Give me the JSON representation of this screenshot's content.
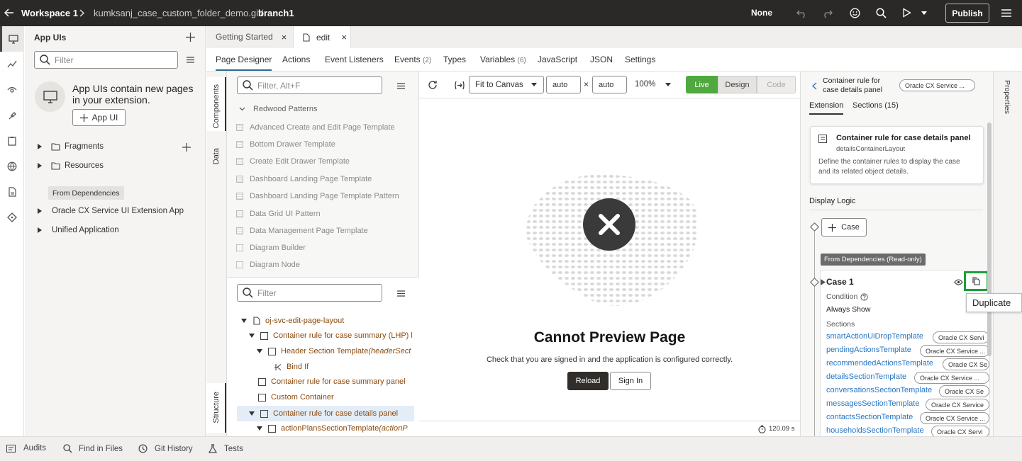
{
  "header": {
    "workspace": "Workspace 1",
    "repo": "kumksanj_case_custom_folder_demo.git/",
    "branch": "branch1",
    "mode": "None",
    "publish_label": "Publish"
  },
  "rail": {
    "icons": [
      "monitor-icon",
      "flow-icon",
      "eye-icon",
      "paint-icon",
      "clipboard-icon",
      "globe-icon",
      "document-icon",
      "git-icon"
    ]
  },
  "navigator": {
    "title": "App UIs",
    "filter_placeholder": "Filter",
    "empty_message_line1": "App UIs contain new pages",
    "empty_message_line2": "in your extension.",
    "app_ui_button": "App UI",
    "fragments": "Fragments",
    "resources": "Resources",
    "from_dependencies": "From Dependencies",
    "dep_items": [
      "Oracle CX Service UI Extension App",
      "Unified Application"
    ]
  },
  "editor_tabs": [
    {
      "label": "Getting Started"
    },
    {
      "label": "edit"
    }
  ],
  "sub_tabs": [
    {
      "label": "Page Designer",
      "count": ""
    },
    {
      "label": "Actions",
      "count": ""
    },
    {
      "label": "Event Listeners",
      "count": ""
    },
    {
      "label": "Events",
      "count": "(2)"
    },
    {
      "label": "Types",
      "count": ""
    },
    {
      "label": "Variables",
      "count": "(6)"
    },
    {
      "label": "JavaScript",
      "count": ""
    },
    {
      "label": "JSON",
      "count": ""
    },
    {
      "label": "Settings",
      "count": ""
    }
  ],
  "side_tabs": {
    "components": "Components",
    "data": "Data",
    "structure": "Structure"
  },
  "components": {
    "filter_placeholder": "Filter, Alt+F",
    "group": "Redwood Patterns",
    "items": [
      "Advanced Create and Edit Page Template",
      "Bottom Drawer Template",
      "Create Edit Drawer Template",
      "Dashboard Landing Page Template",
      "Dashboard Landing Page Template Pattern",
      "Data Grid UI Pattern",
      "Data Management Page Template",
      "Diagram Builder",
      "Diagram Node"
    ]
  },
  "structure": {
    "filter_placeholder": "Filter",
    "rows": [
      {
        "label": "oj-svc-edit-page-layout",
        "em": ""
      },
      {
        "label": "Container rule for case summary (LHP) l",
        "em": ""
      },
      {
        "label": "Header Section Template ",
        "em": "(headerSect"
      },
      {
        "label": "Bind If",
        "em": ""
      },
      {
        "label": "Container rule for case summary panel",
        "em": ""
      },
      {
        "label": "Custom Container",
        "em": ""
      },
      {
        "label": "Container rule for case details panel",
        "em": ""
      },
      {
        "label": "actionPlansSectionTemplate ",
        "em": "(actionP"
      }
    ]
  },
  "canvas_toolbar": {
    "fit": "Fit to Canvas",
    "width": "auto",
    "times": "×",
    "height": "auto",
    "zoom": "100%",
    "modes": [
      "Live",
      "Design",
      "Code"
    ]
  },
  "canvas": {
    "title": "Cannot Preview Page",
    "message": "Check that you are signed in and the application is configured correctly.",
    "reload": "Reload",
    "sign_in": "Sign In",
    "timer": "120.09 s"
  },
  "properties": {
    "side_tab": "Properties",
    "back_title_line1": "Container rule for",
    "back_title_line2": "case details panel",
    "app_chip": "Oracle CX Service ...",
    "tabs": [
      "Extension",
      "Sections (15)"
    ],
    "card_title": "Container rule for case details panel",
    "card_id": "detailsContainerLayout",
    "card_desc_line1": "Define the container rules to display the case",
    "card_desc_line2": "and its related object details.",
    "display_logic": "Display Logic",
    "add_case": "Case",
    "from_dep_badge": "From Dependencies (Read-only)",
    "case_title": "Case 1",
    "condition_label": "Condition",
    "condition_value": "Always Show",
    "sections_label": "Sections",
    "sections": [
      {
        "name": "smartActionUiDropTemplate",
        "chip": "Oracle CX Servi"
      },
      {
        "name": "pendingActionsTemplate",
        "chip": "Oracle CX Service ..."
      },
      {
        "name": "recommendedActionsTemplate",
        "chip": "Oracle CX Se"
      },
      {
        "name": "detailsSectionTemplate",
        "chip": "Oracle CX Service ..."
      },
      {
        "name": "conversationsSectionTemplate",
        "chip": "Oracle CX Se"
      },
      {
        "name": "messagesSectionTemplate",
        "chip": "Oracle CX Service"
      },
      {
        "name": "contactsSectionTemplate",
        "chip": "Oracle CX Service ..."
      },
      {
        "name": "householdsSectionTemplate",
        "chip": "Oracle CX Servi"
      }
    ],
    "tooltip": "Duplicate"
  },
  "footer": {
    "items": [
      "Audits",
      "Find in Files",
      "Git History",
      "Tests"
    ]
  },
  "colors": {
    "header_bg": "#2b2927",
    "live_green": "#4fa93e",
    "highlight_green": "#1e9e3a",
    "link_blue": "#2776c5",
    "structure_brown": "#8a4a0e"
  }
}
